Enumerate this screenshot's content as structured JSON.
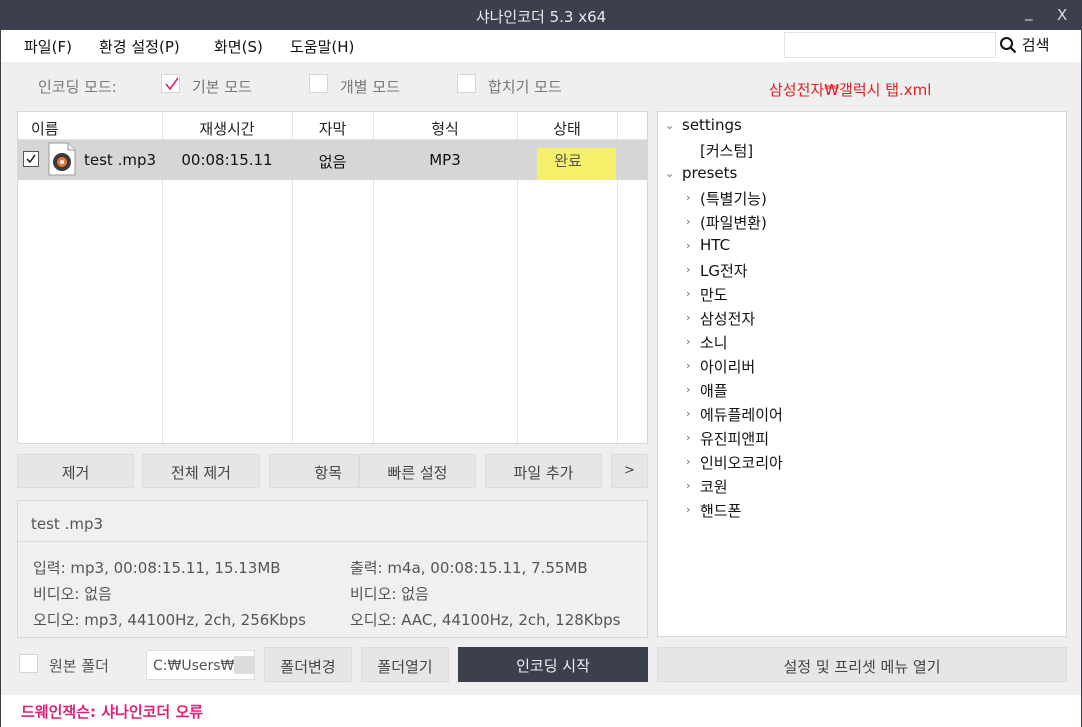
{
  "window": {
    "title": "샤나인코더  5.3  x64",
    "minimize": "_",
    "close": "X"
  },
  "menu": {
    "items": [
      "파일(F)",
      "환경 설정(P)",
      "화면(S)",
      "도움말(H)"
    ]
  },
  "search": {
    "placeholder": "",
    "button_label": "검색"
  },
  "encoding_mode": {
    "label": "인코딩 모드:",
    "options": [
      {
        "label": "기본 모드",
        "checked": true
      },
      {
        "label": "개별 모드",
        "checked": false
      },
      {
        "label": "합치기 모드",
        "checked": false
      }
    ],
    "preset_file": "삼성전자₩갤럭시 탭.xml"
  },
  "file_list": {
    "columns": [
      "이름",
      "재생시간",
      "자막",
      "형식",
      "상태"
    ],
    "rows": [
      {
        "checked": true,
        "name": "test .mp3",
        "duration": "00:08:15.11",
        "subtitle": "없음",
        "format": "MP3",
        "status": "완료"
      }
    ]
  },
  "buttons": {
    "remove": "제거",
    "remove_all": "전체 제거",
    "items": "항목",
    "quick_settings": "빠른 설정",
    "add_file": "파일 추가",
    "more": ">",
    "change_folder": "폴더변경",
    "open_folder": "폴더열기",
    "start_encoding": "인코딩 시작",
    "open_settings_menu": "설정 및 프리셋 메뉴 열기"
  },
  "info": {
    "file_name": "test .mp3",
    "input": "입력: mp3, 00:08:15.11, 15.13MB",
    "input_video": "비디오: 없음",
    "input_audio": "오디오: mp3, 44100Hz, 2ch, 256Kbps",
    "output": "출력: m4a, 00:08:15.11, 7.55MB",
    "output_video": "비디오: 없음",
    "output_audio": "오디오: AAC, 44100Hz, 2ch, 128Kbps"
  },
  "output_folder": {
    "label": "원본 폴더",
    "checked": false,
    "path": "C:₩Users₩"
  },
  "tree": {
    "settings": {
      "label": "settings",
      "children": [
        "[커스텀]"
      ]
    },
    "presets": {
      "label": "presets",
      "children": [
        "(특별기능)",
        "(파일변환)",
        "HTC",
        "LG전자",
        "만도",
        "삼성전자",
        "소니",
        "아이리버",
        "애플",
        "에듀플레이어",
        "유진피앤피",
        "인비오코리아",
        "코원",
        "핸드폰"
      ]
    }
  },
  "status_bar": {
    "message": "드웨인잭슨: 샤나인코더 오류"
  },
  "colors": {
    "titlebar": "#3c3f4d",
    "status_highlight": "#f6ef6a",
    "preset_path": "#e02020",
    "status_message": "#e0207a",
    "check_mark": "#e0207a"
  }
}
